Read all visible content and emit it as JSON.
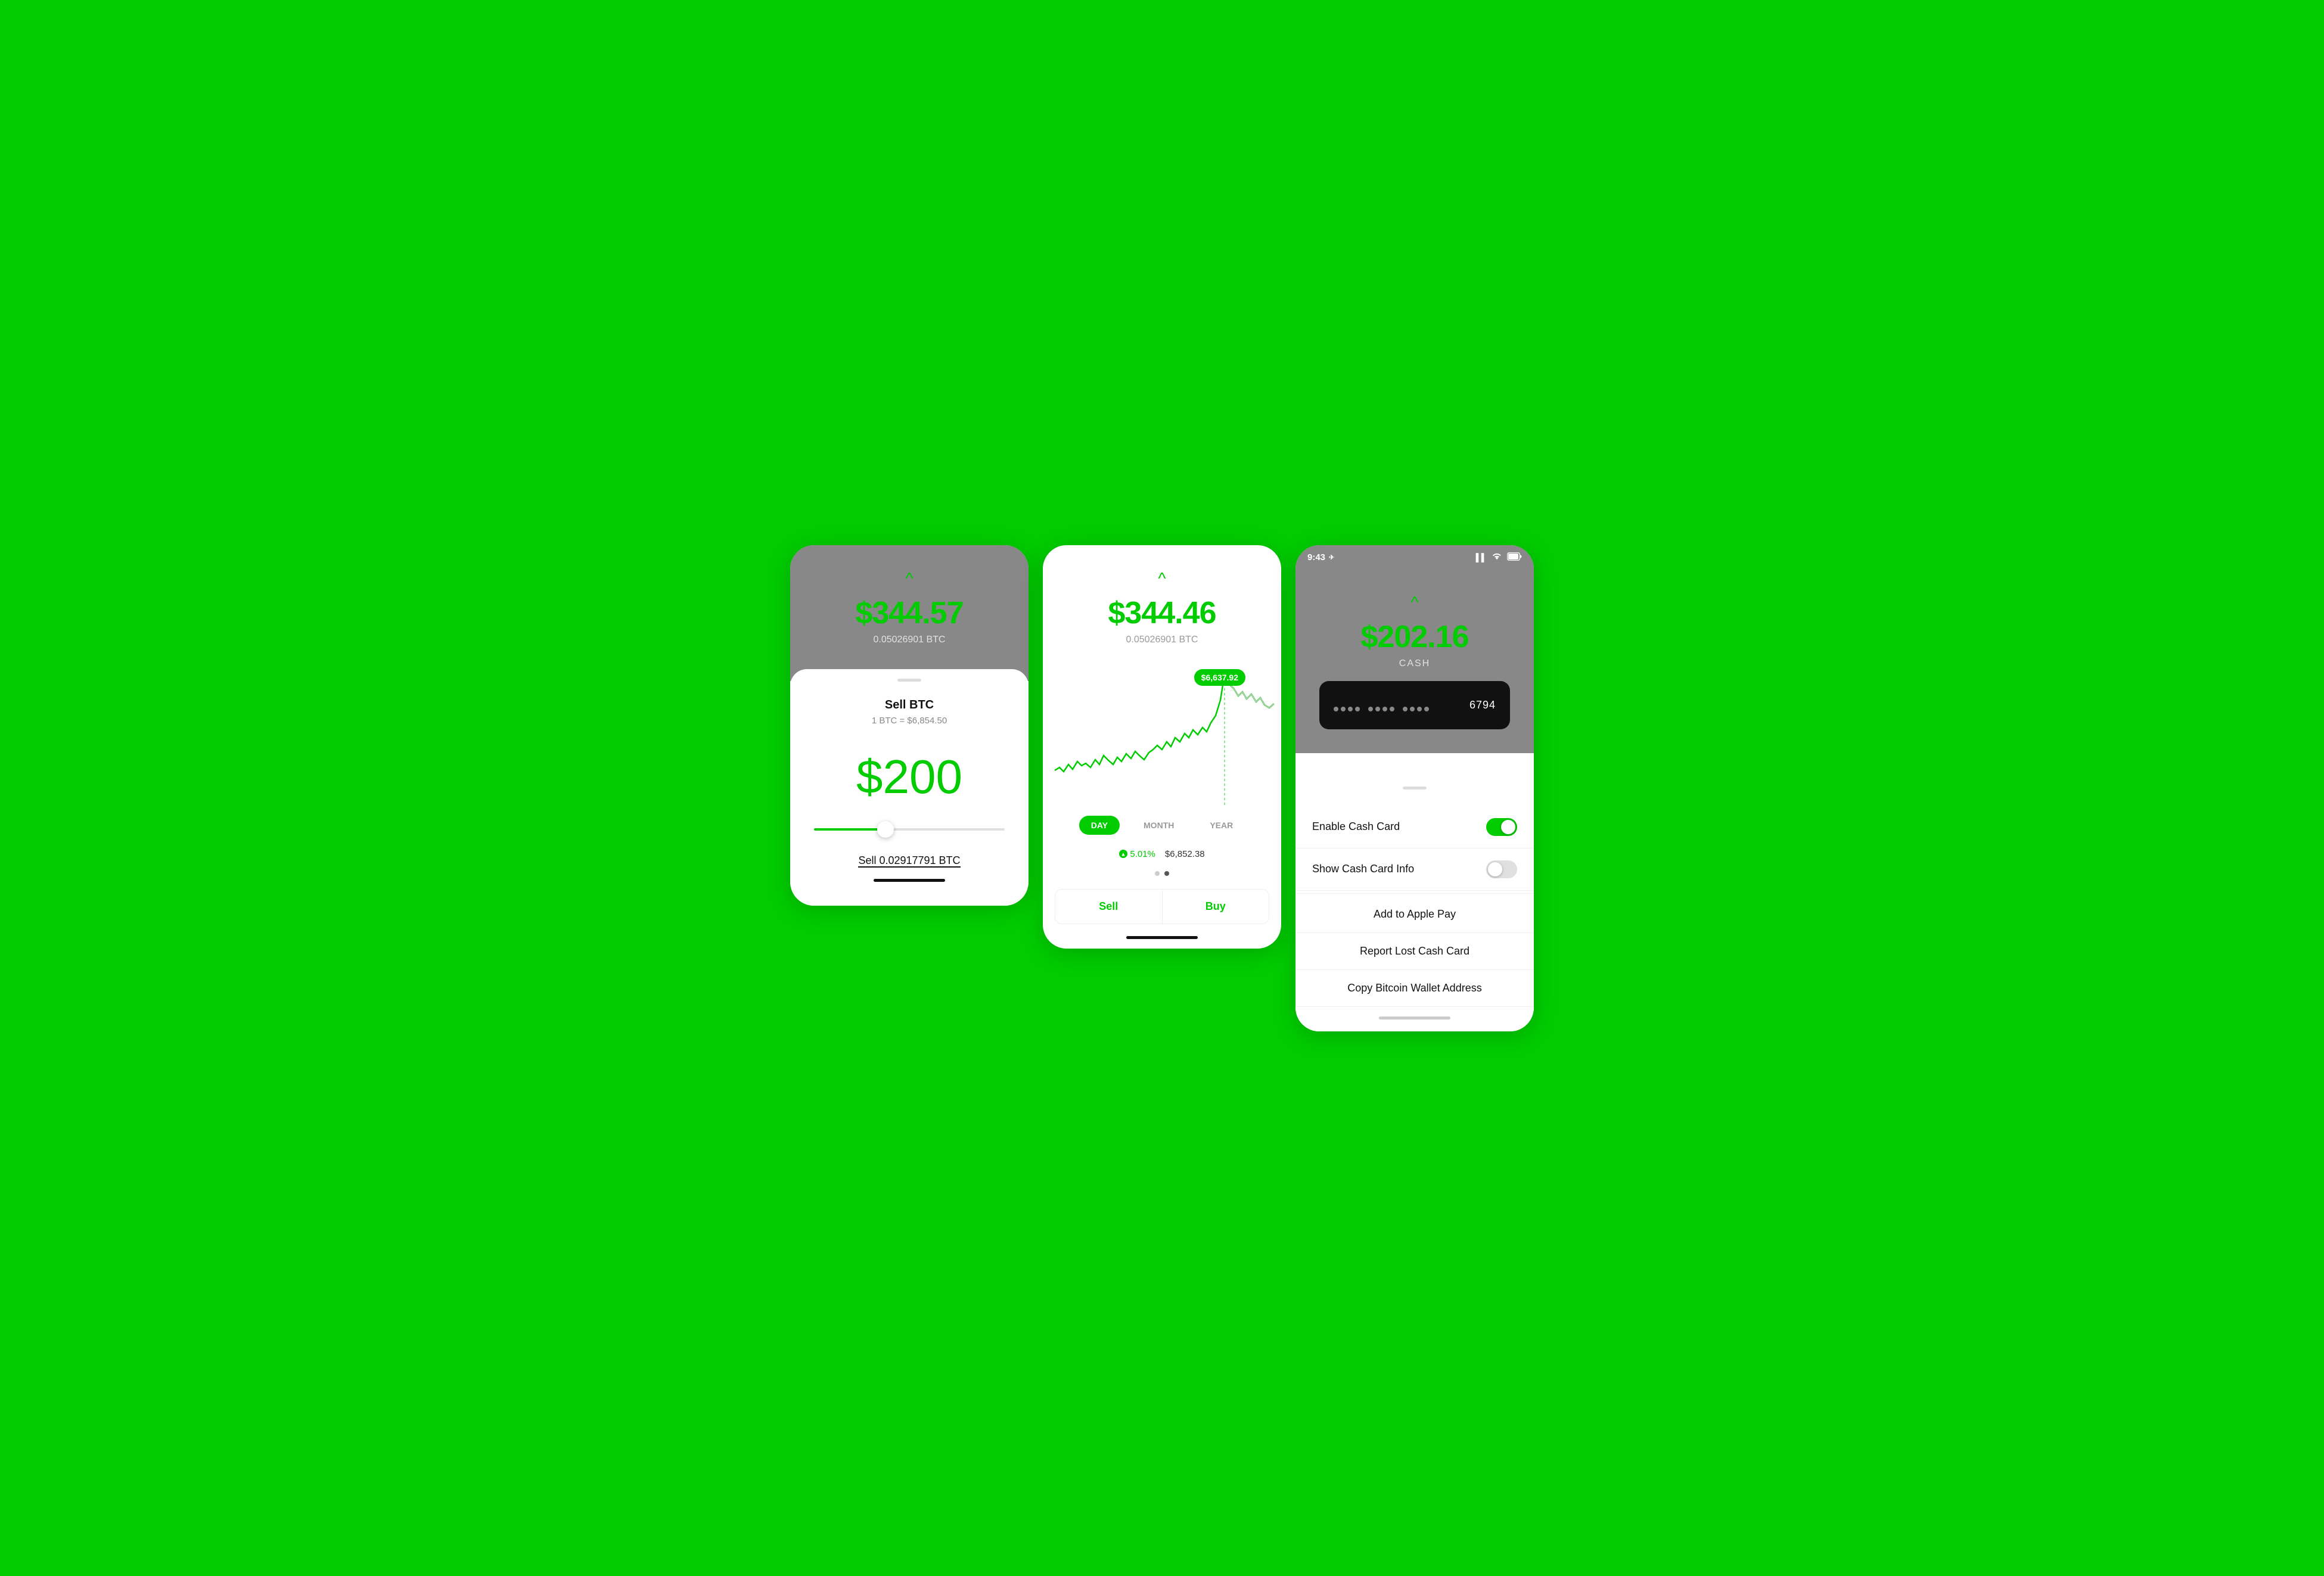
{
  "background_color": "#00CC00",
  "screen1": {
    "top": {
      "chevron": "^",
      "amount": "$344.57",
      "btc_amount": "0.05026901 BTC"
    },
    "sheet": {
      "drag_handle": true,
      "title": "Sell BTC",
      "rate": "1 BTC = $6,854.50",
      "dollar_value": "$200",
      "slider_percent": 38,
      "sell_label": "Sell 0.02917791 BTC"
    }
  },
  "screen2": {
    "top": {
      "chevron": "^",
      "amount": "$344.46",
      "btc_amount": "0.05026901 BTC"
    },
    "chart": {
      "tooltip_value": "$6,637.92",
      "tooltip_visible": true
    },
    "time_selector": {
      "options": [
        "DAY",
        "MONTH",
        "YEAR"
      ],
      "active": "DAY"
    },
    "stats": {
      "change_pct": "5.01%",
      "price": "$6,852.38"
    },
    "actions": {
      "sell": "Sell",
      "buy": "Buy"
    }
  },
  "screen3": {
    "status_bar": {
      "time": "9:43",
      "location_icon": "✈",
      "signal": "▌▌",
      "wifi": "wifi",
      "battery": "battery"
    },
    "top": {
      "chevron": "^",
      "amount": "$202.16",
      "cash_label": "CASH"
    },
    "card": {
      "dots_group1": [
        "•",
        "•",
        "•",
        "•"
      ],
      "dots_group2": [
        "•",
        "•",
        "•",
        "•"
      ],
      "dots_group3": [
        "•",
        "•",
        "•",
        "•"
      ],
      "last_digits": "6794"
    },
    "menu": {
      "enable_cash_card": "Enable Cash Card",
      "enable_cash_card_toggle": true,
      "show_cash_card_info": "Show Cash Card Info",
      "show_cash_card_info_toggle": false,
      "add_to_apple_pay": "Add to Apple Pay",
      "report_lost_cash_card": "Report Lost Cash Card",
      "copy_bitcoin_wallet_address": "Copy Bitcoin Wallet Address"
    }
  }
}
